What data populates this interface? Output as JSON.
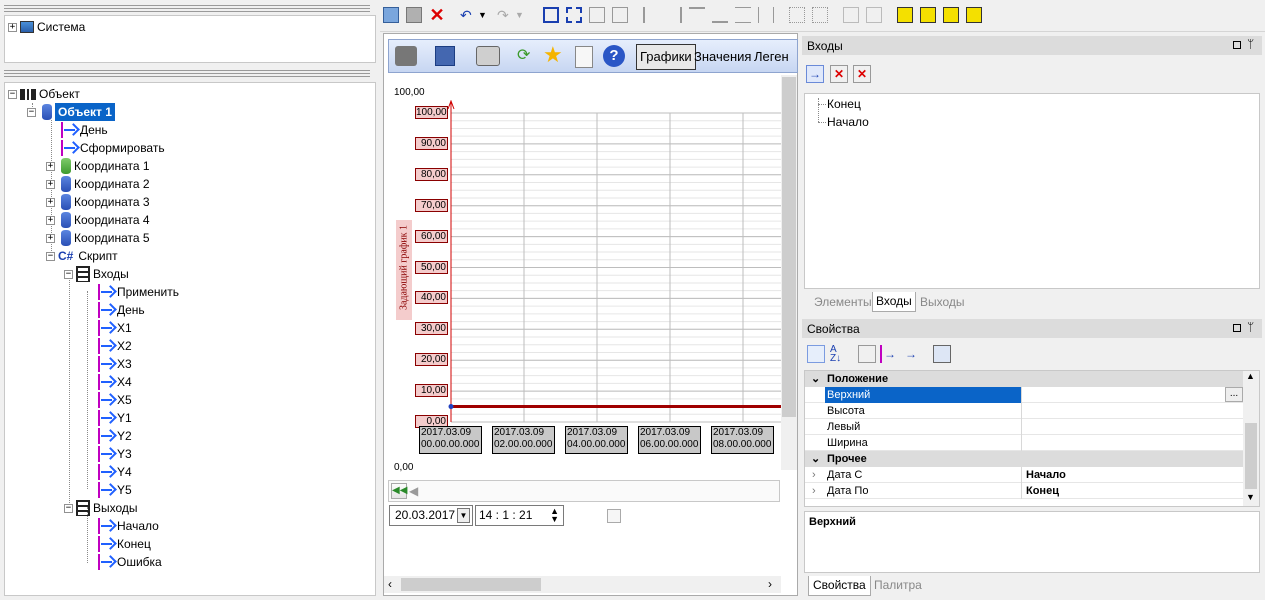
{
  "left_top_tree": {
    "root_label": "Система"
  },
  "object_tree": {
    "root_label": "Объект",
    "selected_label": "Объект 1",
    "items": [
      {
        "label": "День"
      },
      {
        "label": "Сформировать"
      },
      {
        "label": "Координата 1"
      },
      {
        "label": "Координата 2"
      },
      {
        "label": "Координата 3"
      },
      {
        "label": "Координата 4"
      },
      {
        "label": "Координата 5"
      },
      {
        "label": "Скрипт",
        "prefix": "C#"
      },
      {
        "label": "Входы"
      },
      {
        "label": "Применить"
      },
      {
        "label": "День"
      },
      {
        "label": "X1"
      },
      {
        "label": "X2"
      },
      {
        "label": "X3"
      },
      {
        "label": "X4"
      },
      {
        "label": "X5"
      },
      {
        "label": "Y1"
      },
      {
        "label": "Y2"
      },
      {
        "label": "Y3"
      },
      {
        "label": "Y4"
      },
      {
        "label": "Y5"
      },
      {
        "label": "Выходы"
      },
      {
        "label": "Начало"
      },
      {
        "label": "Конец"
      },
      {
        "label": "Ошибка"
      }
    ]
  },
  "chart_toolbar": {
    "tabs": [
      "Графики",
      "Значения",
      "Леген"
    ]
  },
  "chart_area": {
    "top_label": "100,00",
    "bottom_label": "0,00",
    "date_value": "20.03.2017",
    "time_value": "14 : 1 : 21"
  },
  "chart_data": {
    "type": "line",
    "title": "",
    "ylabel": "Задающий график 1",
    "ylim": [
      0,
      100
    ],
    "yticks": [
      "100,00",
      "90,00",
      "80,00",
      "70,00",
      "60,00",
      "50,00",
      "40,00",
      "30,00",
      "20,00",
      "10,00",
      "0,00"
    ],
    "xticks": [
      {
        "date": "2017.03.09",
        "time": "00.00.00.000"
      },
      {
        "date": "2017.03.09",
        "time": "02.00.00.000"
      },
      {
        "date": "2017.03.09",
        "time": "04.00.00.000"
      },
      {
        "date": "2017.03.09",
        "time": "06.00.00.000"
      },
      {
        "date": "2017.03.09",
        "time": "08.00.00.000"
      }
    ],
    "series": [
      {
        "color": "#a00000",
        "values": [
          5,
          5,
          5,
          5,
          5
        ]
      }
    ],
    "grid": true
  },
  "inputs_panel": {
    "title": "Входы",
    "items": [
      "Конец",
      "Начало"
    ],
    "tabs": [
      "Элементы",
      "Входы",
      "Выходы"
    ]
  },
  "properties_panel": {
    "title": "Свойства",
    "categories": [
      {
        "name": "Положение",
        "rows": [
          {
            "name": "Верхний",
            "value": ""
          },
          {
            "name": "Высота",
            "value": ""
          },
          {
            "name": "Левый",
            "value": ""
          },
          {
            "name": "Ширина",
            "value": ""
          }
        ]
      },
      {
        "name": "Прочее",
        "rows": [
          {
            "name": "Дата С",
            "value": "Начало"
          },
          {
            "name": "Дата По",
            "value": "Конец"
          }
        ]
      }
    ],
    "ellipsis": "...",
    "description_title": "Верхний",
    "tabs": [
      "Свойства",
      "Палитра"
    ]
  },
  "colors": {
    "selection": "#0a64c8",
    "panel_header": "#dcdcdc",
    "chart_series": "#a00000",
    "tick_bg": "#f4cccc"
  }
}
